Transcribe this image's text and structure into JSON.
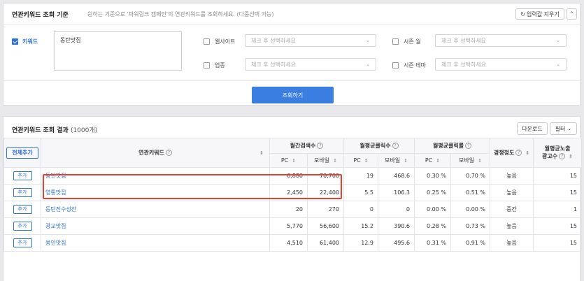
{
  "search": {
    "title": "연관키워드 조회 기준",
    "description": "원하는 기준으로 '파워링크 캠페인'의 연관키워드를 조회하세요. (다중선택 가능)",
    "reset_label": "입력값 지우기",
    "collapse_glyph": "^",
    "keyword_label": "키워드",
    "keyword_value": "동탄맛집",
    "website_label": "웹사이트",
    "industry_label": "업종",
    "season_month_label": "시즌 월",
    "season_theme_label": "시즌 테마",
    "select_placeholder": "체크 후 선택하세요",
    "submit_label": "조회하기"
  },
  "results": {
    "title": "연관키워드 조회 결과",
    "count": "(1000개)",
    "download_label": "다운로드",
    "filter_label": "필터",
    "add_all_label": "전체추가",
    "add_label": "추가",
    "headers": {
      "keyword": "연관키워드",
      "monthly_searches": "월간검색수",
      "monthly_avg_clicks": "월평균클릭수",
      "monthly_avg_ctr": "월평균클릭률",
      "competition": "경쟁정도",
      "avg_ad_count_line1": "월평균노출",
      "avg_ad_count_line2": "광고수",
      "pc": "PC",
      "mobile": "모바일"
    },
    "rows": [
      {
        "keyword": "동탄맛집",
        "pc_search": "6,880",
        "mobile_search": "70,700",
        "pc_click": "19",
        "mobile_click": "468.6",
        "pc_ctr": "0.30 %",
        "mobile_ctr": "0.70 %",
        "competition": "높음",
        "ad_count": "15"
      },
      {
        "keyword": "영통맛집",
        "pc_search": "2,450",
        "mobile_search": "22,400",
        "pc_click": "5.5",
        "mobile_click": "106.3",
        "pc_ctr": "0.25 %",
        "mobile_ctr": "0.51 %",
        "competition": "높음",
        "ad_count": "15"
      },
      {
        "keyword": "동탄진수성찬",
        "pc_search": "20",
        "mobile_search": "270",
        "pc_click": "0",
        "mobile_click": "0",
        "pc_ctr": "0.00 %",
        "mobile_ctr": "0.00 %",
        "competition": "중간",
        "ad_count": "1"
      },
      {
        "keyword": "광교맛집",
        "pc_search": "5,770",
        "mobile_search": "56,600",
        "pc_click": "15.2",
        "mobile_click": "390.6",
        "pc_ctr": "0.28 %",
        "mobile_ctr": "0.73 %",
        "competition": "높음",
        "ad_count": "15"
      },
      {
        "keyword": "용인맛집",
        "pc_search": "4,510",
        "mobile_search": "61,400",
        "pc_click": "12.9",
        "mobile_click": "495.6",
        "pc_ctr": "0.31 %",
        "mobile_ctr": "0.91 %",
        "competition": "높음",
        "ad_count": "15"
      }
    ]
  },
  "colors": {
    "accent": "#2b71d9",
    "submit_button": "#3a7ee2",
    "highlight_box": "#e4412e"
  }
}
